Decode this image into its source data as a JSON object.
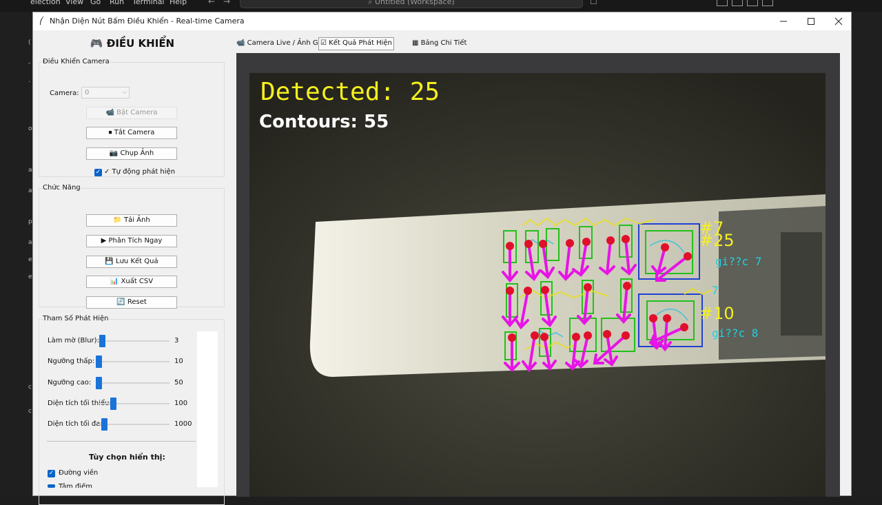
{
  "vscode": {
    "menu": [
      "election",
      "View",
      "Go",
      "Run",
      "Terminal",
      "Help"
    ],
    "search": "Untitled (Workspace)"
  },
  "window": {
    "title": "Nhận Diện Nút Bấm Điều Khiển - Real-time Camera"
  },
  "panel": {
    "title": "🎮 ĐIỀU KHIỂN",
    "camera_group": {
      "label": "Điều Khiển Camera",
      "camera_label": "Camera:",
      "camera_value": "0",
      "start_button": "📹 Bật Camera",
      "stop_button": "⏹ Tắt Camera",
      "capture_button": "📷 Chụp Ảnh",
      "auto_detect": "✓ Tự động phát hiện"
    },
    "function_group": {
      "label": "Chức Năng",
      "load_button": "📁 Tải Ảnh",
      "analyze_button": "▶ Phân Tích Ngay",
      "save_button": "💾 Lưu Kết Quả",
      "csv_button": "📊 Xuất CSV",
      "reset_button": "🔄 Reset"
    },
    "params_group": {
      "label": "Tham Số Phát Hiện",
      "sliders": [
        {
          "label": "Làm mờ (Blur):",
          "value": "3",
          "fraction": 0.05
        },
        {
          "label": "Ngưỡng thấp:",
          "value": "10",
          "fraction": 0.0
        },
        {
          "label": "Ngưỡng cao:",
          "value": "50",
          "fraction": 0.0
        },
        {
          "label": "Diện tích tối thiểu:",
          "value": "100",
          "fraction": 0.2
        },
        {
          "label": "Diện tích tối đa:",
          "value": "1000",
          "fraction": 0.08
        }
      ],
      "display_options_title": "Tùy chọn hiển thị:",
      "options": [
        "Đường viền",
        "Tâm điểm"
      ]
    }
  },
  "tabs": [
    "📹 Camera Live / Ảnh Gốc",
    "☑ Kết Quả Phát Hiện",
    "▦ Bảng Chi Tiết"
  ],
  "overlay": {
    "detected": "Detected: 25",
    "contours": "Contours: 55",
    "labels": [
      "#7",
      "#25",
      "#10",
      "gi??c 7",
      "gi??c 8",
      "7"
    ]
  },
  "colors": {
    "detected_text": "#f5f01e",
    "contours_text": "#ffffff",
    "arrow": "#e614e6",
    "point": "#e0102a",
    "box_green": "#22c01a",
    "box_blue": "#2040d0",
    "accent": "#1a73d9"
  }
}
